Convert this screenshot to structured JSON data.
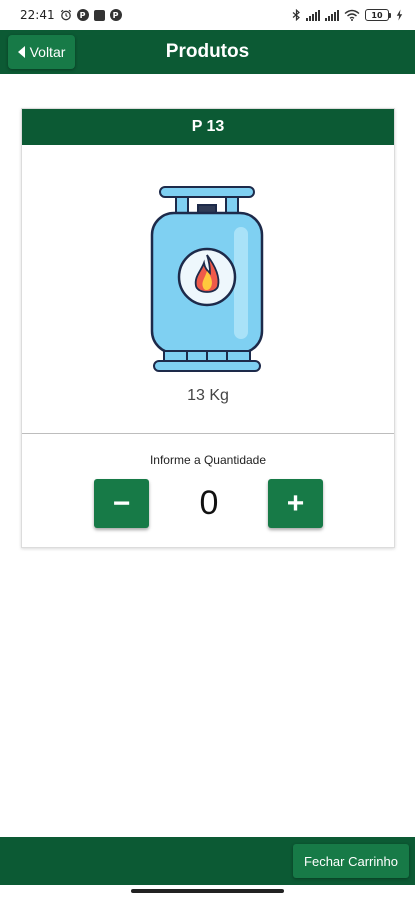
{
  "status_bar": {
    "time": "22:41",
    "battery": "10",
    "icons": [
      "alarm-icon",
      "p-icon",
      "square-icon",
      "p-icon",
      "bluetooth-icon",
      "signal-icon",
      "signal-icon",
      "wifi-icon",
      "battery-icon",
      "charging-icon"
    ]
  },
  "header": {
    "back_label": "Voltar",
    "title": "Produtos"
  },
  "product": {
    "name": "P 13",
    "image_icon": "gas-cylinder-icon",
    "weight": "13 Kg",
    "quantity_label": "Informe a Quantidade",
    "quantity": "0",
    "minus_label": "−",
    "plus_label": "+"
  },
  "footer": {
    "checkout_label": "Fechar Carrinho"
  },
  "colors": {
    "header_green": "#0c5a34",
    "button_green": "#177a47",
    "cylinder_blue": "#7fd0f2",
    "outline": "#1d2a4a"
  }
}
